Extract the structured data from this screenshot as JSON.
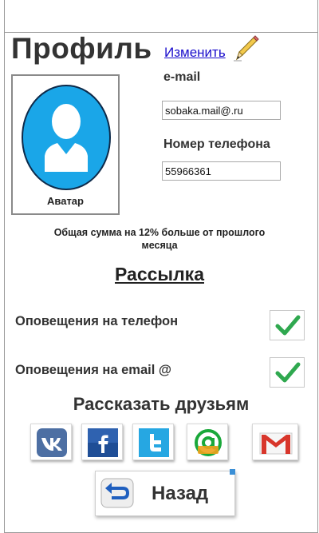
{
  "header": {
    "title": "Профиль",
    "edit_label": "Изменить"
  },
  "avatar": {
    "label": "Аватар"
  },
  "email": {
    "label": "e-mail",
    "value": "sobaka.mail@.ru"
  },
  "phone": {
    "label": "Номер телефона",
    "value": "55966361"
  },
  "notice": "Общая  сумма на 12% больше от прошлого месяца",
  "mailing": {
    "title": "Рассылка",
    "options": [
      {
        "label": "Оповещения на телефон",
        "checked": true
      },
      {
        "label": "Оповещения на email @",
        "checked": true
      }
    ]
  },
  "share": {
    "title": "Рассказать друзьям",
    "networks": [
      {
        "icon": "vk-icon"
      },
      {
        "icon": "facebook-icon"
      },
      {
        "icon": "twitter-icon"
      },
      {
        "icon": "mail-agent-icon"
      },
      {
        "icon": "gmail-icon"
      }
    ]
  },
  "back": {
    "label": "Назад"
  },
  "colors": {
    "avatar_blue": "#1aa6e8",
    "link": "#1a0dcc",
    "check_green": "#2fa84f",
    "vk": "#4d6fa3",
    "facebook": "#2f62b0",
    "twitter": "#26a7e2",
    "mail_agent": "#1aa83a",
    "gmail_red": "#d8362b"
  }
}
